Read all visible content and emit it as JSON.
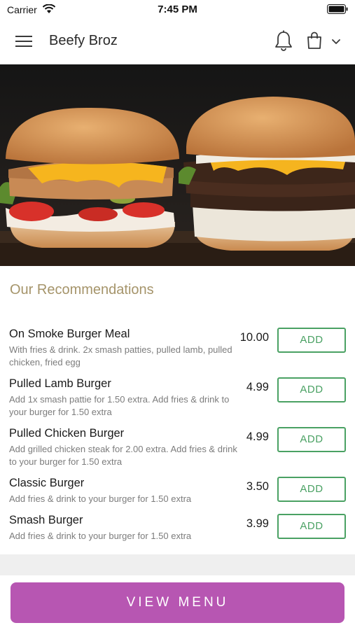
{
  "status_bar": {
    "carrier": "Carrier",
    "time": "7:45 PM"
  },
  "nav": {
    "title": "Beefy Broz",
    "icons": [
      "menu-icon",
      "bell-icon",
      "shopping-bag-icon",
      "chevron-down-icon"
    ]
  },
  "hero": {
    "description": "two burgers photo"
  },
  "recommendations": {
    "title": "Our Recommendations",
    "items": [
      {
        "name": "On Smoke Burger Meal",
        "description": "With fries & drink. 2x smash patties, pulled lamb, pulled chicken, fried egg",
        "price": "10.00",
        "button": "ADD"
      },
      {
        "name": "Pulled Lamb Burger",
        "description": "Add 1x smash pattie for 1.50 extra. Add fries & drink to your burger for 1.50 extra",
        "price": "4.99",
        "button": "ADD"
      },
      {
        "name": "Pulled Chicken Burger",
        "description": "Add grilled chicken steak for 2.00 extra. Add fries & drink to your burger for 1.50 extra",
        "price": "4.99",
        "button": "ADD"
      },
      {
        "name": "Classic Burger",
        "description": "Add fries & drink to your burger for 1.50 extra",
        "price": "3.50",
        "button": "ADD"
      },
      {
        "name": "Smash Burger",
        "description": "Add fries & drink to your burger for 1.50 extra",
        "price": "3.99",
        "button": "ADD"
      }
    ]
  },
  "footer": {
    "view_menu_label": "VIEW MENU"
  },
  "colors": {
    "accent_green": "#4aa163",
    "accent_purple": "#b756b2",
    "heading_gold": "#a5946a"
  }
}
